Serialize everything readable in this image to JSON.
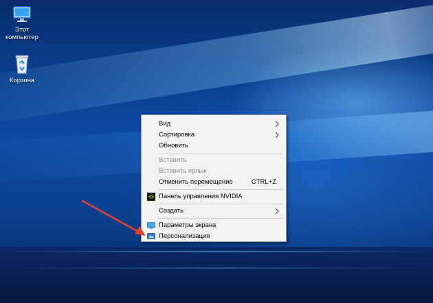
{
  "desktop": {
    "icons": [
      {
        "label_line1": "Этот",
        "label_line2": "компьютер",
        "icon": "this-pc-icon"
      },
      {
        "label": "Корзина",
        "icon": "recycle-bin-icon"
      }
    ]
  },
  "context_menu": {
    "items": [
      {
        "label": "Вид",
        "submenu": true,
        "enabled": true
      },
      {
        "label": "Сортировка",
        "submenu": true,
        "enabled": true
      },
      {
        "label": "Обновить",
        "enabled": true
      },
      {
        "label": "Вставить",
        "enabled": false
      },
      {
        "label": "Вставить ярлык",
        "enabled": false
      },
      {
        "label": "Отменить перемещение",
        "shortcut": "CTRL+Z",
        "enabled": true
      },
      {
        "label": "Панель управления NVIDIA",
        "icon": "nvidia-icon",
        "enabled": true
      },
      {
        "label": "Создать",
        "submenu": true,
        "enabled": true
      },
      {
        "label": "Параметры экрана",
        "icon": "display-settings-icon",
        "enabled": true
      },
      {
        "label": "Персонализация",
        "icon": "personalization-icon",
        "enabled": true
      }
    ]
  },
  "annotation": {
    "arrow_color": "#e8412c"
  },
  "colors": {
    "menu_bg": "#f2f2f2",
    "disabled_text": "#8d8d8d",
    "desktop_blue": "#0c4aa6"
  }
}
